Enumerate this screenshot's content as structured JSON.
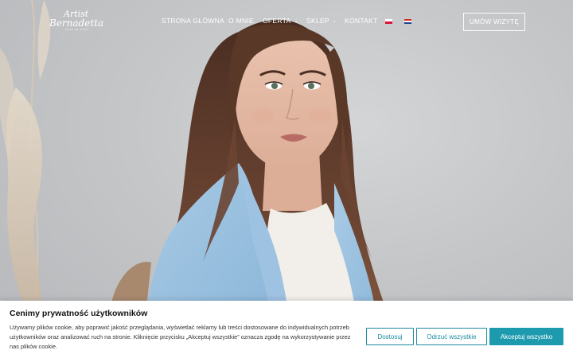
{
  "logo": {
    "line1": "Artist",
    "line2": "Bernadetta",
    "line3": "make-up artist"
  },
  "nav": {
    "items": [
      {
        "label": "STRONA GŁÓWNA"
      },
      {
        "label": "O MNIE"
      },
      {
        "label": "OFERTA",
        "caret": "⌄"
      },
      {
        "label": "SKLEP",
        "caret": "⌄"
      },
      {
        "label": "KONTAKT"
      }
    ],
    "flags": [
      "flag-pl-icon",
      "flag-hr-icon"
    ]
  },
  "cta": {
    "label": "UMÓW WIZYTĘ"
  },
  "cookie": {
    "title": "Cenimy prywatność użytkowników",
    "text": "Używamy plików cookie, aby poprawić jakość przeglądania, wyświetlać reklamy lub treści dostosowane do indywidualnych potrzeb użytkowników oraz analizować ruch na stronie. Kliknięcie przycisku „Akceptuj wszystkie” oznacza zgodę na wykorzystywanie przez nas plików cookie.",
    "customize_label": "Dostosuj",
    "reject_label": "Odrzuć wszystkie",
    "accept_label": "Akceptuj wszystko",
    "accent": "#1e9aae"
  }
}
